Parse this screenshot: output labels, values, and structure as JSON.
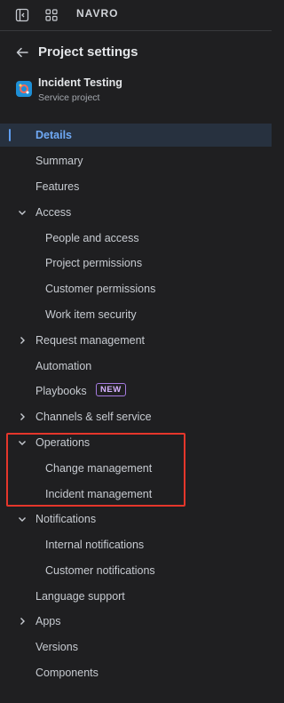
{
  "topbar": {
    "logo_text": "NAVRO",
    "icons": [
      "sidebar-toggle-icon",
      "app-switcher-icon"
    ]
  },
  "header": {
    "back_icon": "arrow-left-icon",
    "title": "Project settings"
  },
  "project": {
    "name": "Incident Testing",
    "type": "Service project",
    "avatar_color": "#1e8fd6"
  },
  "nav": {
    "details": "Details",
    "summary": "Summary",
    "features": "Features",
    "access": "Access",
    "people_access": "People and access",
    "project_permissions": "Project permissions",
    "customer_permissions": "Customer permissions",
    "work_item_security": "Work item security",
    "request_management": "Request management",
    "automation": "Automation",
    "playbooks": "Playbooks",
    "playbooks_badge": "NEW",
    "channels": "Channels & self service",
    "operations": "Operations",
    "change_management": "Change management",
    "incident_management": "Incident management",
    "notifications": "Notifications",
    "internal_notifications": "Internal notifications",
    "customer_notifications": "Customer notifications",
    "language_support": "Language support",
    "apps": "Apps",
    "versions": "Versions",
    "components": "Components"
  },
  "colors": {
    "background": "#1f1f21",
    "active_text": "#6fa9f5",
    "active_bg": "#27313f",
    "highlight_border": "#e5362b"
  }
}
